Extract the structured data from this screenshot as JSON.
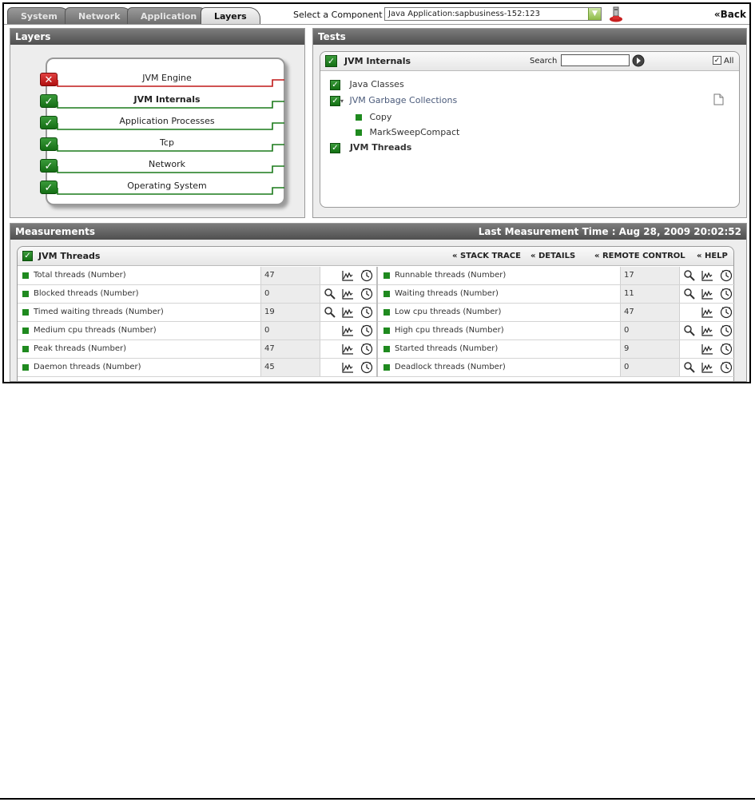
{
  "tabs": [
    {
      "label": "System",
      "active": false
    },
    {
      "label": "Network",
      "active": false
    },
    {
      "label": "Application",
      "active": false
    },
    {
      "label": "Layers",
      "active": true
    }
  ],
  "component": {
    "label": "Select a Component",
    "selected": "Java Application:sapbusiness-152:123"
  },
  "back_label": "Back",
  "layers_panel": {
    "title": "Layers",
    "items": [
      {
        "label": "JVM Engine",
        "status": "error",
        "bold": false
      },
      {
        "label": "JVM Internals",
        "status": "ok",
        "bold": true
      },
      {
        "label": "Application Processes",
        "status": "ok",
        "bold": false
      },
      {
        "label": "Tcp",
        "status": "ok",
        "bold": false
      },
      {
        "label": "Network",
        "status": "ok",
        "bold": false
      },
      {
        "label": "Operating System",
        "status": "ok",
        "bold": false
      }
    ]
  },
  "tests_panel": {
    "title": "Tests",
    "heading": "JVM Internals",
    "search_label": "Search",
    "search_value": "",
    "all_label": "All",
    "tree": [
      {
        "label": "Java Classes"
      },
      {
        "label": "JVM Garbage Collections"
      },
      {
        "label": "Copy"
      },
      {
        "label": "MarkSweepCompact"
      },
      {
        "label": "JVM Threads"
      }
    ]
  },
  "measurements": {
    "title": "Measurements",
    "last_time": "Last Measurement Time : Aug 28, 2009 20:02:52",
    "heading": "JVM Threads",
    "links": [
      "STACK TRACE",
      "DETAILS",
      "REMOTE CONTROL",
      "HELP"
    ],
    "rows": [
      {
        "left_name": "Total threads (Number)",
        "left_value": "47",
        "left_zoom": false,
        "right_name": "Runnable threads (Number)",
        "right_value": "17",
        "right_zoom": true
      },
      {
        "left_name": "Blocked threads (Number)",
        "left_value": "0",
        "left_zoom": true,
        "right_name": "Waiting threads (Number)",
        "right_value": "11",
        "right_zoom": true
      },
      {
        "left_name": "Timed waiting threads (Number)",
        "left_value": "19",
        "left_zoom": true,
        "right_name": "Low cpu threads (Number)",
        "right_value": "47",
        "right_zoom": false
      },
      {
        "left_name": "Medium cpu threads (Number)",
        "left_value": "0",
        "left_zoom": false,
        "right_name": "High cpu threads (Number)",
        "right_value": "0",
        "right_zoom": true
      },
      {
        "left_name": "Peak threads (Number)",
        "left_value": "47",
        "left_zoom": false,
        "right_name": "Started threads (Number)",
        "right_value": "9",
        "right_zoom": false
      },
      {
        "left_name": "Daemon threads (Number)",
        "left_value": "45",
        "left_zoom": false,
        "right_name": "Deadlock threads (Number)",
        "right_value": "0",
        "right_zoom": true
      }
    ]
  },
  "colors": {
    "ok": "#1a7a1a",
    "error": "#c01818",
    "header": "#5a5a5a"
  }
}
